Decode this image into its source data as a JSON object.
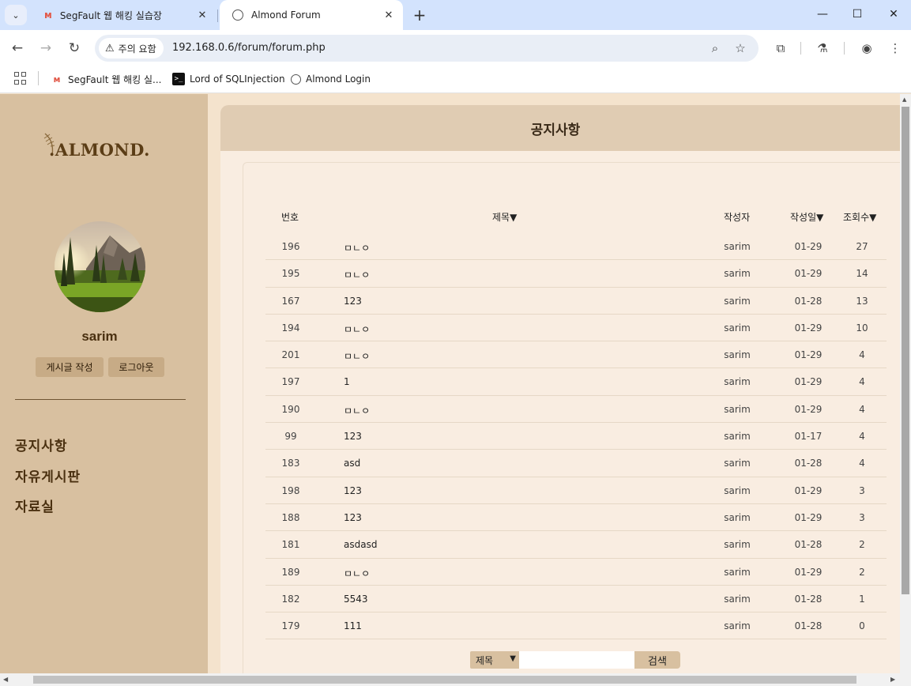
{
  "browser": {
    "tabs": [
      {
        "title": "SegFault 웹 해킹 실습장",
        "icon": "segfault-favicon",
        "active": false
      },
      {
        "title": "Almond Forum",
        "icon": "globe-icon",
        "active": true
      }
    ],
    "security_chip": "주의 요함",
    "url": "192.168.0.6/forum/forum.php",
    "bookmarks": [
      {
        "label": "SegFault 웹 해킹 실...",
        "icon": "segfault-favicon"
      },
      {
        "label": "Lord of SQLInjection",
        "icon": "terminal-icon"
      },
      {
        "label": "Almond Login",
        "icon": "globe-icon"
      }
    ]
  },
  "sidebar": {
    "logo_text": ".ALMOND.",
    "username": "sarim",
    "write_button": "게시글 작성",
    "logout_button": "로그아웃",
    "nav": [
      "공지사항",
      "자유게시판",
      "자료실"
    ]
  },
  "board": {
    "title": "공지사항",
    "columns": {
      "number": "번호",
      "title": "제목▼",
      "author": "작성자",
      "date": "작성일▼",
      "views": "조회수▼"
    },
    "rows": [
      {
        "number": "196",
        "title": "ㅁㄴㅇ",
        "author": "sarim",
        "date": "01-29",
        "views": "27"
      },
      {
        "number": "195",
        "title": "ㅁㄴㅇ",
        "author": "sarim",
        "date": "01-29",
        "views": "14"
      },
      {
        "number": "167",
        "title": "123",
        "author": "sarim",
        "date": "01-28",
        "views": "13"
      },
      {
        "number": "194",
        "title": "ㅁㄴㅇ",
        "author": "sarim",
        "date": "01-29",
        "views": "10"
      },
      {
        "number": "201",
        "title": "ㅁㄴㅇ",
        "author": "sarim",
        "date": "01-29",
        "views": "4"
      },
      {
        "number": "197",
        "title": "1",
        "author": "sarim",
        "date": "01-29",
        "views": "4"
      },
      {
        "number": "190",
        "title": "ㅁㄴㅇ",
        "author": "sarim",
        "date": "01-29",
        "views": "4"
      },
      {
        "number": "99",
        "title": "123",
        "author": "sarim",
        "date": "01-17",
        "views": "4"
      },
      {
        "number": "183",
        "title": "asd",
        "author": "sarim",
        "date": "01-28",
        "views": "4"
      },
      {
        "number": "198",
        "title": "123",
        "author": "sarim",
        "date": "01-29",
        "views": "3"
      },
      {
        "number": "188",
        "title": "123",
        "author": "sarim",
        "date": "01-29",
        "views": "3"
      },
      {
        "number": "181",
        "title": "asdasd",
        "author": "sarim",
        "date": "01-28",
        "views": "2"
      },
      {
        "number": "189",
        "title": "ㅁㄴㅇ",
        "author": "sarim",
        "date": "01-29",
        "views": "2"
      },
      {
        "number": "182",
        "title": "5543",
        "author": "sarim",
        "date": "01-28",
        "views": "1"
      },
      {
        "number": "179",
        "title": "111",
        "author": "sarim",
        "date": "01-28",
        "views": "0"
      }
    ],
    "search": {
      "field_selected": "제목",
      "query": "",
      "button": "검색"
    }
  }
}
